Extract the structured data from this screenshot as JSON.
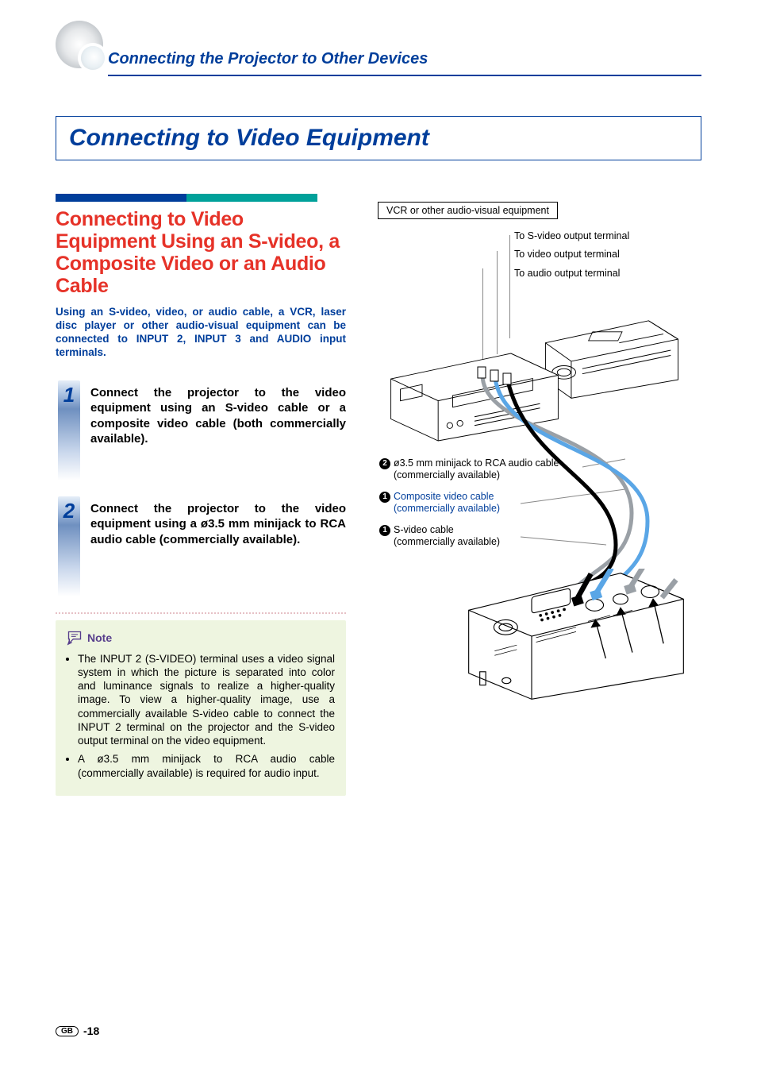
{
  "header": {
    "title": "Connecting the Projector to Other Devices"
  },
  "banner": {
    "title": "Connecting to Video Equipment"
  },
  "section": {
    "heading": "Connecting to Video Equipment Using an S-video, a Composite Video or an Audio Cable",
    "intro": "Using an S-video, video, or audio cable, a VCR, laser disc player or other audio-visual equipment can be connected to INPUT 2, INPUT 3 and AUDIO input terminals."
  },
  "steps": [
    {
      "num": "1",
      "text": "Connect the projector to the video equipment using an S-video cable or a composite video cable (both commercially available)."
    },
    {
      "num": "2",
      "text": "Connect the projector to the video equipment using a ø3.5 mm minijack to RCA audio cable (commercially available)."
    }
  ],
  "note": {
    "label": "Note",
    "items": [
      "The INPUT 2 (S-VIDEO) terminal uses a video signal system in which the picture is separated into color and luminance signals to realize a higher-quality image. To view a higher-quality image, use a commercially available S-video cable to connect the INPUT 2 terminal on the projector and the S-video output terminal on the video equipment.",
      "A ø3.5 mm minijack to RCA audio cable (commercially available) is required for audio input."
    ]
  },
  "diagram": {
    "vcr_label": "VCR or other audio-visual equipment",
    "leads": {
      "svideo_out": "To S-video output terminal",
      "video_out": "To video output terminal",
      "audio_out": "To audio output terminal"
    },
    "callouts": {
      "audio": {
        "bullet": "2",
        "line1": "ø3.5 mm minijack to RCA audio cable",
        "line2": "(commercially available)"
      },
      "composite": {
        "bullet": "1",
        "line1": "Composite video cable",
        "line2": "(commercially available)"
      },
      "svideo": {
        "bullet": "1",
        "line1": "S-video cable",
        "line2": "(commercially available)"
      }
    }
  },
  "footer": {
    "region": "GB",
    "page": "-18"
  }
}
